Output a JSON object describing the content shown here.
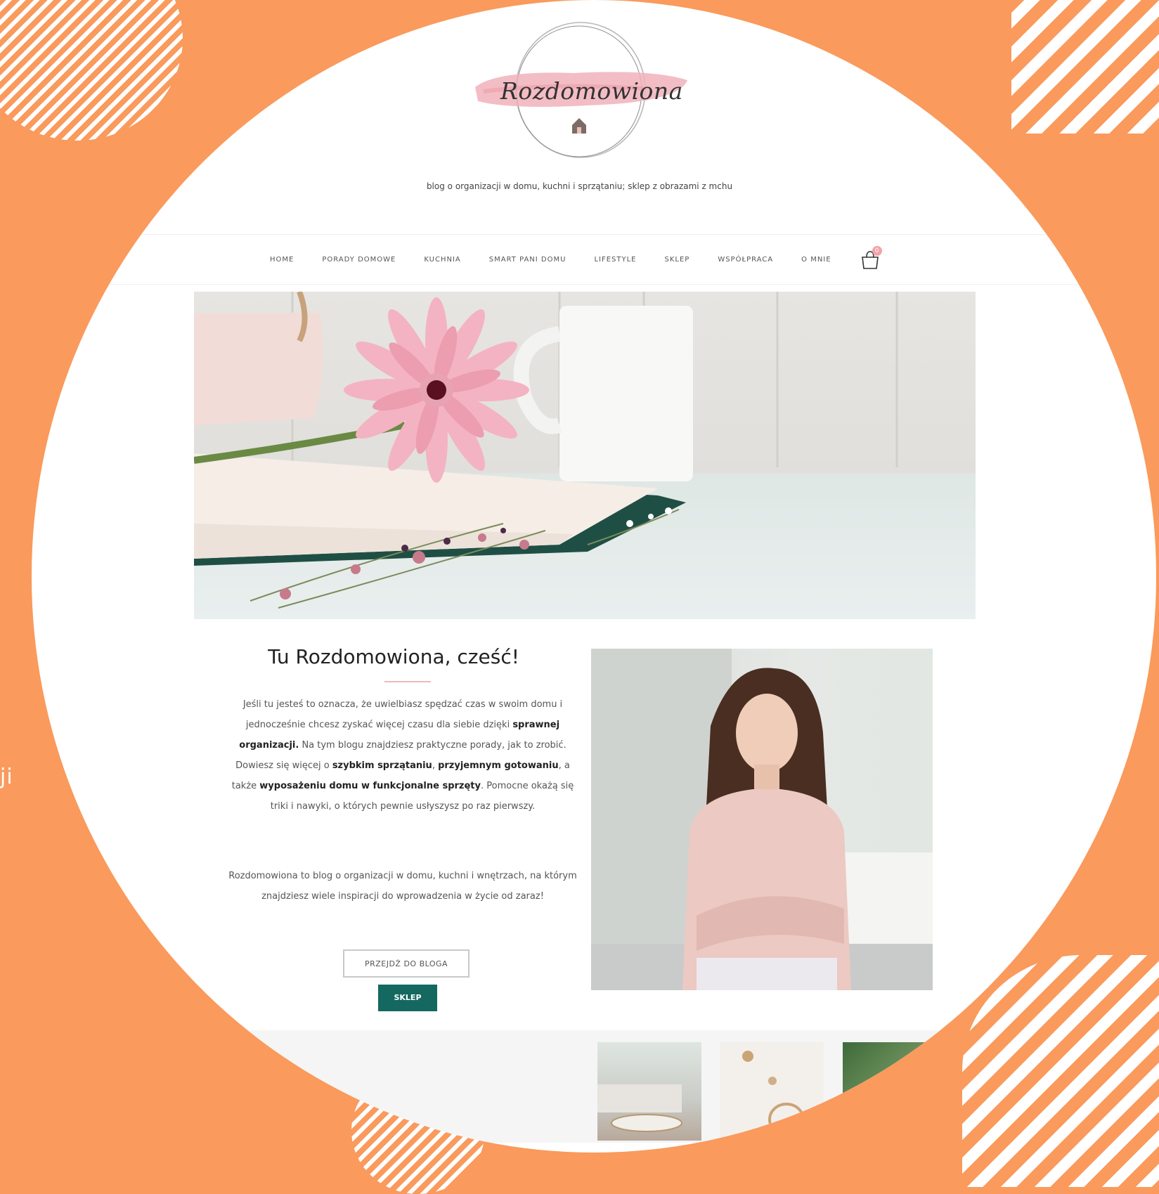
{
  "site": {
    "logo_text": "Rozdomowiona",
    "tagline": "blog o organizacji w domu, kuchni i sprzątaniu; sklep z obrazami z mchu"
  },
  "nav": {
    "items": [
      {
        "label": "HOME"
      },
      {
        "label": "PORADY DOMOWE"
      },
      {
        "label": "KUCHNIA"
      },
      {
        "label": "SMART PANI DOMU"
      },
      {
        "label": "LIFESTYLE"
      },
      {
        "label": "SKLEP"
      },
      {
        "label": "WSPÓŁPRACA"
      },
      {
        "label": "O MNIE"
      }
    ],
    "cart_count": "0"
  },
  "intro": {
    "title": "Tu Rozdomowiona, cześć!",
    "p1": [
      {
        "t": "Jeśli tu jesteś to oznacza, że uwielbiasz spędzać czas w swoim domu i jednocześnie chcesz zyskać więcej czasu dla siebie dzięki "
      },
      {
        "t": "sprawnej organizacji.",
        "b": true
      },
      {
        "t": " Na tym blogu znajdziesz praktyczne porady, jak to zrobić. Dowiesz się więcej o "
      },
      {
        "t": "szybkim sprzątaniu",
        "b": true
      },
      {
        "t": ", "
      },
      {
        "t": "przyjemnym gotowaniu",
        "b": true
      },
      {
        "t": ", a także "
      },
      {
        "t": "wyposażeniu domu w funkcjonalne sprzęty",
        "b": true
      },
      {
        "t": ". Pomocne okażą się triki i nawyki, o których pewnie usłyszysz po raz pierwszy."
      }
    ],
    "p2": "Rozdomowiona to blog o organizacji w domu, kuchni i wnętrzach, na którym znajdziesz wiele inspiracji do wprowadzenia w życie od zaraz!",
    "btn_blog": "PRZEJDŹ DO BLOGA",
    "btn_shop": "SKLEP"
  },
  "side_text": "ji",
  "colors": {
    "background": "#FA9A5C",
    "accent_green": "#146860",
    "accent_pink": "#F2A3A8"
  }
}
